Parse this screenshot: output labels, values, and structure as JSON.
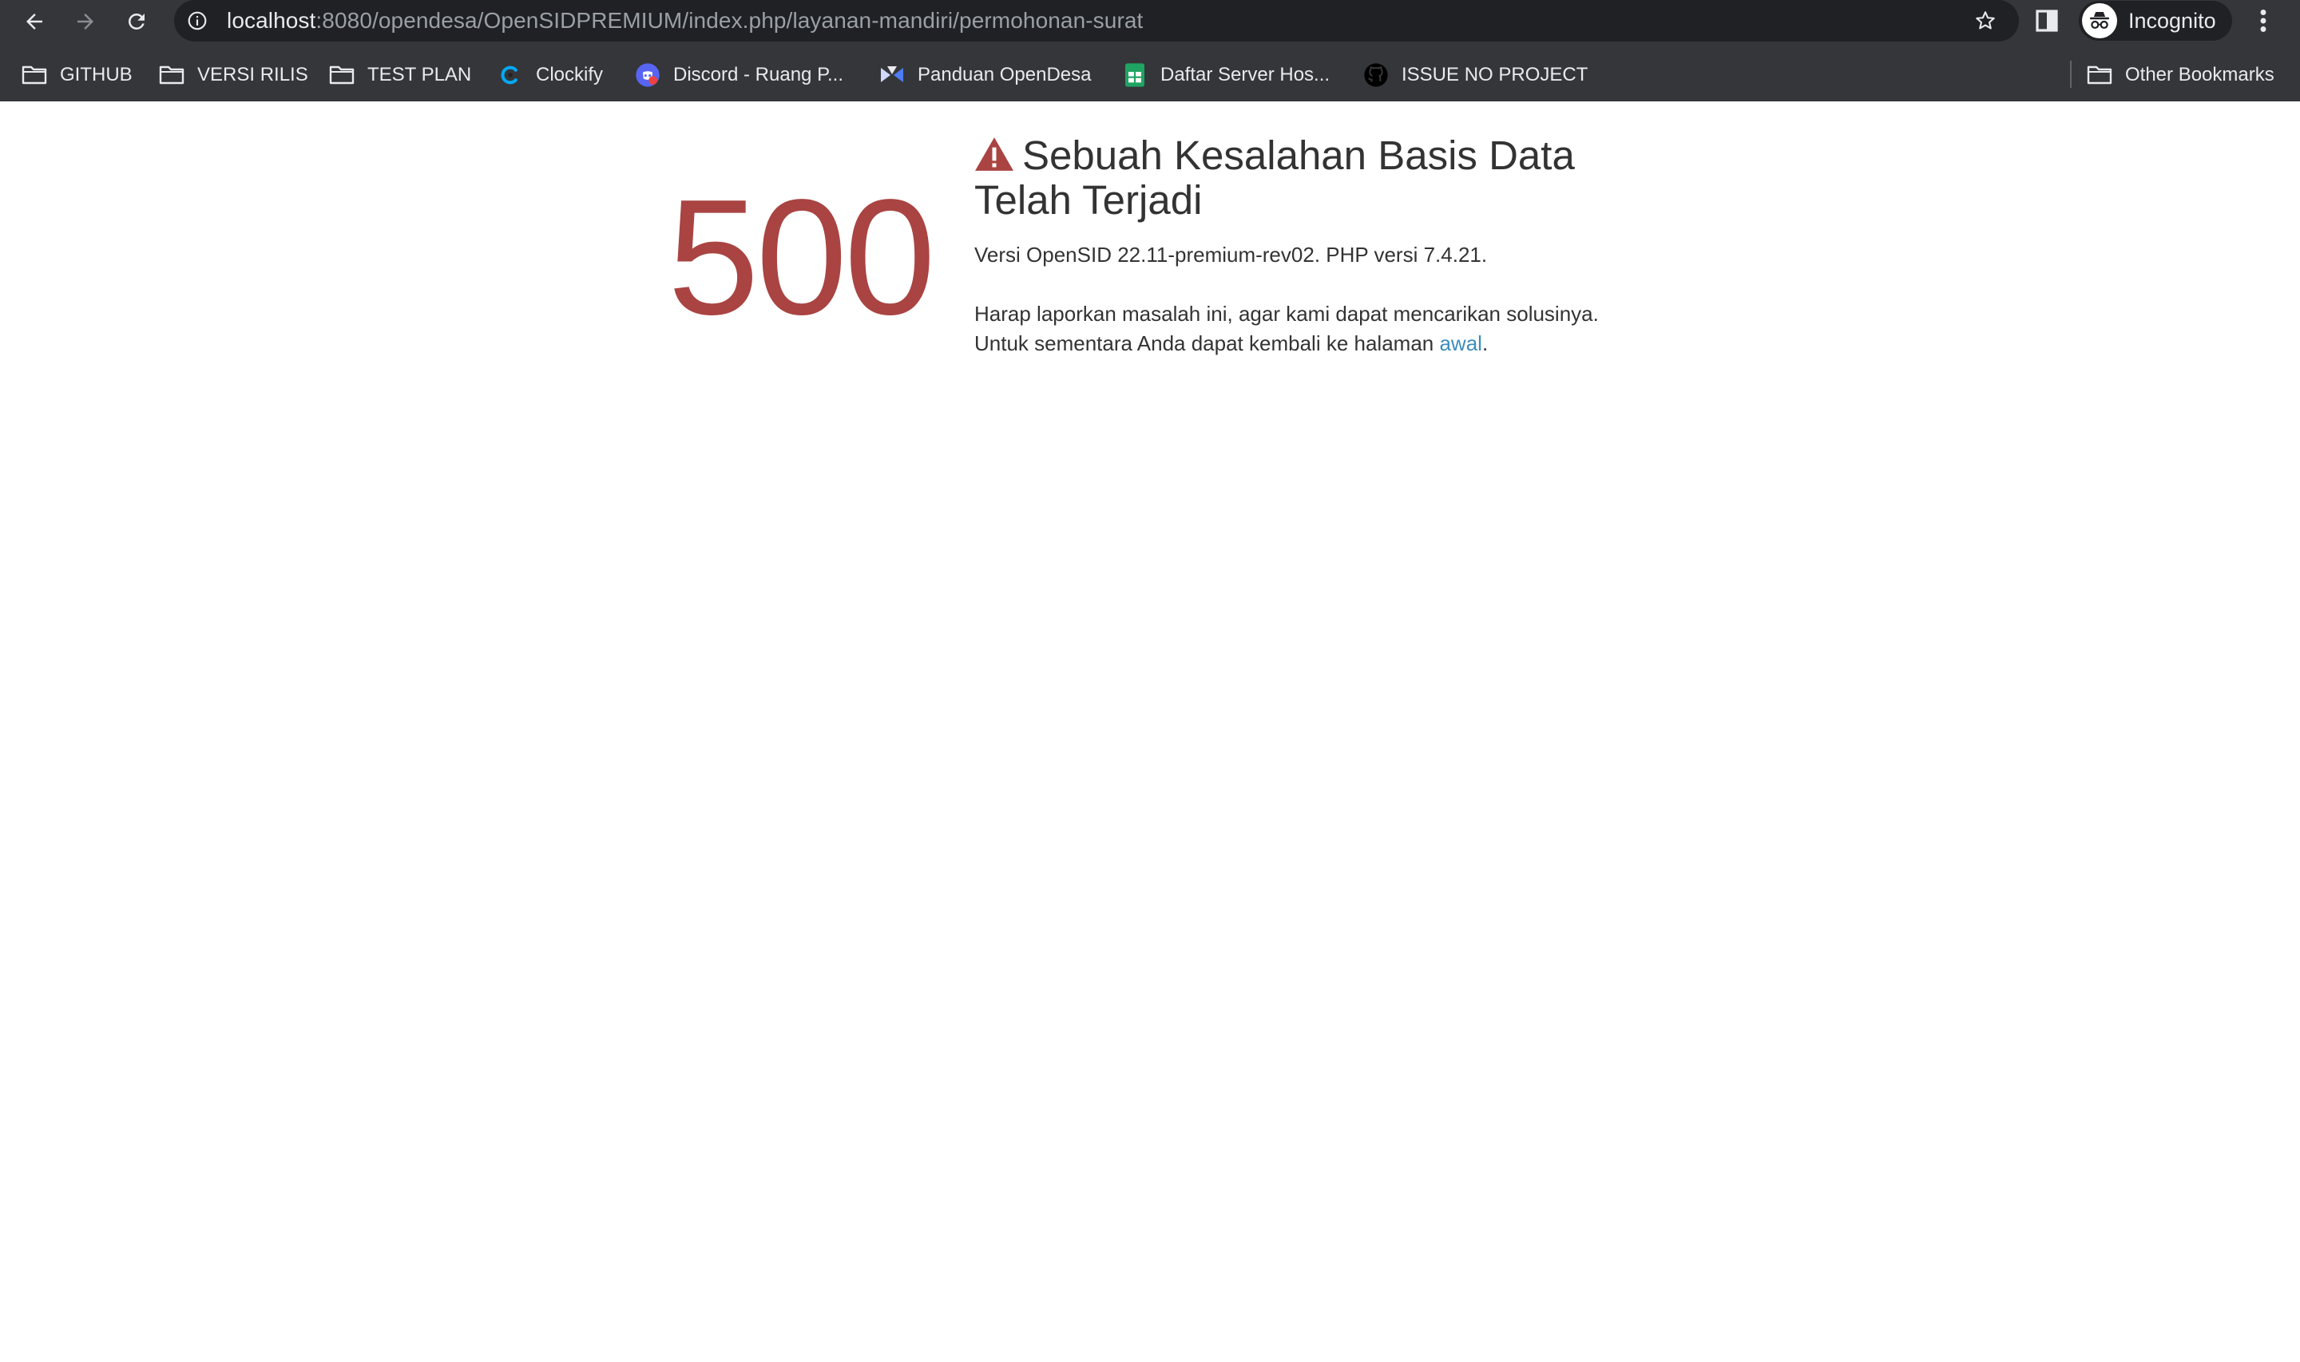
{
  "browser": {
    "url_host": "localhost",
    "url_rest": ":8080/opendesa/OpenSIDPREMIUM/index.php/layanan-mandiri/permohonan-surat",
    "profile_label": "Incognito"
  },
  "bookmarks": {
    "items": [
      {
        "label": "GITHUB",
        "icon": "folder-icon"
      },
      {
        "label": "VERSI RILIS",
        "icon": "folder-icon"
      },
      {
        "label": "TEST PLAN",
        "icon": "folder-icon"
      },
      {
        "label": "Clockify",
        "icon": "clockify-icon"
      },
      {
        "label": "Discord - Ruang P...",
        "icon": "discord-icon"
      },
      {
        "label": "Panduan OpenDesa",
        "icon": "opendesa-icon"
      },
      {
        "label": "Daftar Server Hos...",
        "icon": "sheets-icon"
      },
      {
        "label": "ISSUE NO PROJECT",
        "icon": "github-icon"
      }
    ],
    "other": "Other Bookmarks"
  },
  "error": {
    "code": "500",
    "title": "Sebuah Kesalahan Basis Data Telah Terjadi",
    "version_line": "Versi OpenSID 22.11-premium-rev02. PHP versi 7.4.21.",
    "report_line": "Harap laporkan masalah ini, agar kami dapat mencarikan solusinya.",
    "back_prefix": "Untuk sementara Anda dapat kembali ke halaman ",
    "back_link": "awal",
    "back_suffix": "."
  },
  "colors": {
    "error_red": "#a94442",
    "link_blue": "#3c8dbc",
    "chrome_bg": "#35363a",
    "omnibox_bg": "#202124"
  }
}
